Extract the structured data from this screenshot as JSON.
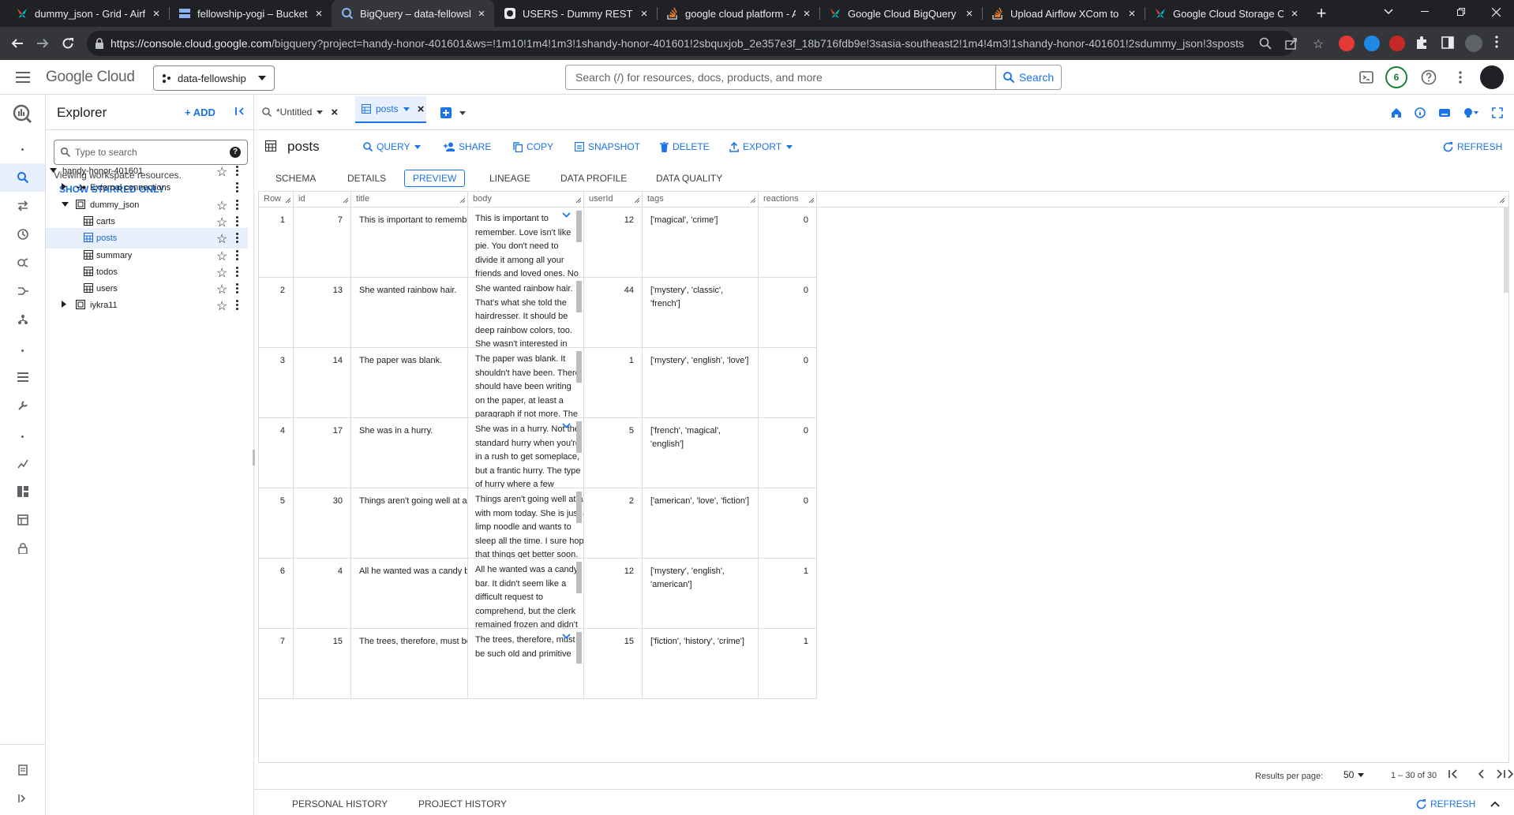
{
  "browser": {
    "tabs": [
      {
        "title": "dummy_json - Grid - Airflo",
        "icon": "airflow-icon"
      },
      {
        "title": "fellowship-yogi – Bucket d",
        "icon": "storage-icon"
      },
      {
        "title": "BigQuery – data-fellowshi",
        "icon": "bigquery-icon"
      },
      {
        "title": "USERS - Dummy REST API",
        "icon": "github-icon"
      },
      {
        "title": "google cloud platform - A",
        "icon": "stackoverflow-icon"
      },
      {
        "title": "Google Cloud BigQuery C",
        "icon": "airflow-icon"
      },
      {
        "title": "Upload Airflow XCom to C",
        "icon": "stackoverflow-icon"
      },
      {
        "title": "Google Cloud Storage Op",
        "icon": "airflow-icon"
      }
    ],
    "new_tab": "+",
    "url_host": "https://console.cloud.google.com",
    "url_path": "/bigquery?project=handy-honor-401601&ws=!1m10!1m4!1m3!1shandy-honor-401601!2sbquxjob_2e357e3f_18b716fdb9e!3sasia-southeast2!1m4!4m3!1shandy-honor-401601!2sdummy_json!3sposts"
  },
  "console": {
    "logo_google": "Google",
    "logo_cloud": "Cloud",
    "project": "data-fellowship",
    "search_placeholder": "Search (/) for resources, docs, products, and more",
    "search_button": "Search",
    "notifications_count": "6"
  },
  "explorer": {
    "title": "Explorer",
    "add": "+ ADD",
    "search_placeholder": "Type to search",
    "viewing": "Viewing workspace resources.",
    "show_starred": "SHOW STARRED ONLY",
    "tree": [
      {
        "label": "handy-honor-401601",
        "level": 0,
        "kind": "project"
      },
      {
        "label": "External connections",
        "level": 1,
        "kind": "connections"
      },
      {
        "label": "dummy_json",
        "level": 1,
        "kind": "dataset"
      },
      {
        "label": "carts",
        "level": 2,
        "kind": "table"
      },
      {
        "label": "posts",
        "level": 2,
        "kind": "table"
      },
      {
        "label": "summary",
        "level": 2,
        "kind": "table"
      },
      {
        "label": "todos",
        "level": 2,
        "kind": "table"
      },
      {
        "label": "users",
        "level": 2,
        "kind": "table"
      },
      {
        "label": "iykra11",
        "level": 1,
        "kind": "dataset"
      }
    ]
  },
  "editor_tabs": [
    {
      "label": "*Untitled",
      "icon": "query-icon"
    },
    {
      "label": "posts",
      "icon": "table-icon"
    }
  ],
  "table": {
    "name": "posts",
    "actions": [
      "QUERY",
      "SHARE",
      "COPY",
      "SNAPSHOT",
      "DELETE",
      "EXPORT"
    ],
    "refresh": "REFRESH",
    "subtabs": [
      "SCHEMA",
      "DETAILS",
      "PREVIEW",
      "LINEAGE",
      "DATA PROFILE",
      "DATA QUALITY"
    ],
    "active_subtab": "PREVIEW",
    "columns": [
      "Row",
      "id",
      "title",
      "body",
      "userId",
      "tags",
      "reactions"
    ],
    "rows": [
      {
        "row": "1",
        "id": "7",
        "title": "This is important to remember.",
        "body": [
          "This is important to",
          "remember. Love isn't like",
          "pie. You don't need to",
          "divide it among all your",
          "friends and loved ones. No"
        ],
        "userId": "12",
        "tags": "['magical', 'crime']",
        "reactions": "0",
        "expand": true
      },
      {
        "row": "2",
        "id": "13",
        "title": "She wanted rainbow hair.",
        "body": [
          "She wanted rainbow hair.",
          "That's what she told the",
          "hairdresser. It should be",
          "deep rainbow colors, too.",
          "She wasn't interested in"
        ],
        "userId": "44",
        "tags": "['mystery', 'classic', 'french']",
        "reactions": "0",
        "expand": false
      },
      {
        "row": "3",
        "id": "14",
        "title": "The paper was blank.",
        "body": [
          "The paper was blank. It",
          "shouldn't have been. There",
          "should have been writing",
          "on the paper, at least a",
          "paragraph if not more. The"
        ],
        "userId": "1",
        "tags": "['mystery', 'english', 'love']",
        "reactions": "0",
        "expand": false
      },
      {
        "row": "4",
        "id": "17",
        "title": "She was in a hurry.",
        "body": [
          "She was in a hurry. Not the",
          "standard hurry when you're",
          "in a rush to get someplace,",
          "but a frantic hurry. The type",
          "of hurry where a few"
        ],
        "userId": "5",
        "tags": "['french', 'magical', 'english']",
        "reactions": "0",
        "expand": true
      },
      {
        "row": "5",
        "id": "30",
        "title": "Things aren't going well at all",
        "body": [
          "Things aren't going well at all",
          "with mom today. She is just a",
          "limp noodle and wants to",
          "sleep all the time. I sure hope",
          "that things get better soon."
        ],
        "userId": "2",
        "tags": "['american', 'love', 'fiction']",
        "reactions": "0",
        "expand": false
      },
      {
        "row": "6",
        "id": "4",
        "title": "All he wanted was a candy bar.",
        "body": [
          "All he wanted was a candy",
          "bar. It didn't seem like a",
          "difficult request to",
          "comprehend, but the clerk",
          "remained frozen and didn't"
        ],
        "userId": "12",
        "tags": "['mystery', 'english', 'american']",
        "reactions": "1",
        "expand": false
      },
      {
        "row": "7",
        "id": "15",
        "title": "The trees, therefore, must be s...",
        "body": [
          "The trees, therefore, must",
          "be such old and primitive"
        ],
        "userId": "15",
        "tags": "['fiction', 'history', 'crime']",
        "reactions": "1",
        "expand": true
      }
    ],
    "results_per_page_label": "Results per page:",
    "results_per_page": "50",
    "range": "1 – 30 of 30"
  },
  "bottom": {
    "personal_history": "PERSONAL HISTORY",
    "project_history": "PROJECT HISTORY",
    "refresh": "REFRESH"
  },
  "colors": {
    "accent": "#1a73e8",
    "selected_bg": "#e8f0fe",
    "chrome_dark": "#202124"
  }
}
